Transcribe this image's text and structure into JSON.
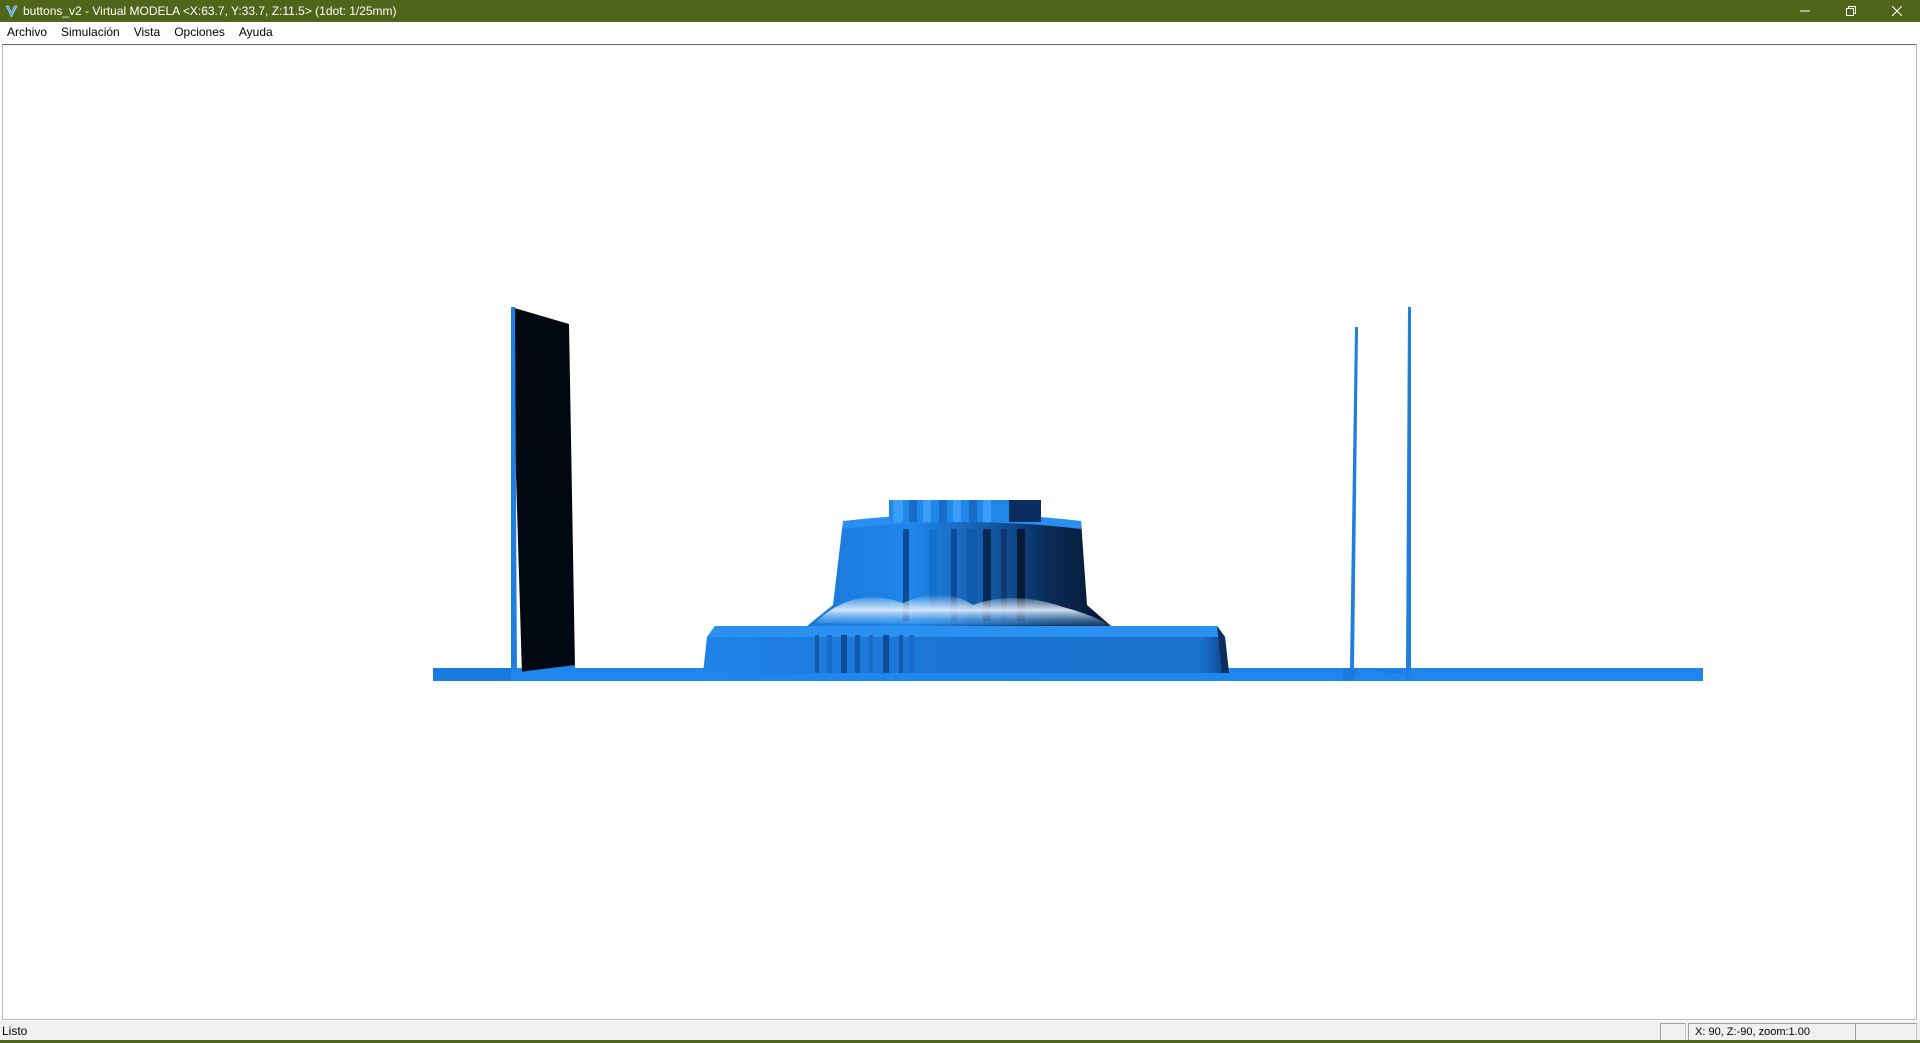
{
  "window": {
    "title": "buttons_v2 - Virtual MODELA <X:63.7, Y:33.7, Z:11.5> (1dot: 1/25mm)",
    "app_icon_letter": "V",
    "titlebar_color": "#4f6519",
    "controls": {
      "minimize_icon": "minimize-icon",
      "restore_icon": "restore-icon",
      "close_icon": "close-icon"
    }
  },
  "menu": {
    "items": [
      {
        "label": "Archivo"
      },
      {
        "label": "Simulación"
      },
      {
        "label": "Vista"
      },
      {
        "label": "Opciones"
      },
      {
        "label": "Ayuda"
      }
    ]
  },
  "viewport": {
    "model_color": "#1f7fe0",
    "background": "#ffffff"
  },
  "status": {
    "text": "Listo",
    "coords": "X: 90, Z:-90, zoom:1.00"
  }
}
